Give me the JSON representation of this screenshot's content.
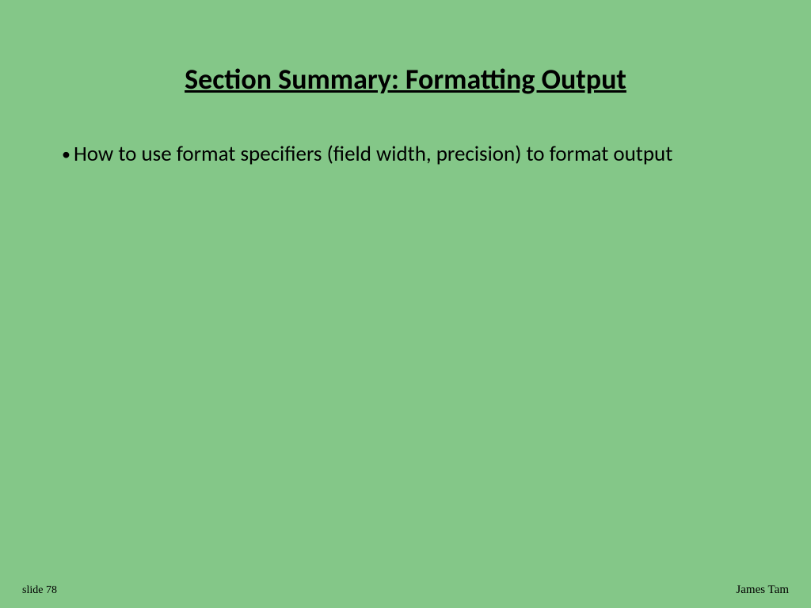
{
  "slide": {
    "title": "Section Summary: Formatting Output",
    "bullets": [
      "How to use format specifiers (field width, precision) to format output"
    ],
    "footer": {
      "slide_number": "slide 78",
      "author": "James Tam"
    }
  }
}
